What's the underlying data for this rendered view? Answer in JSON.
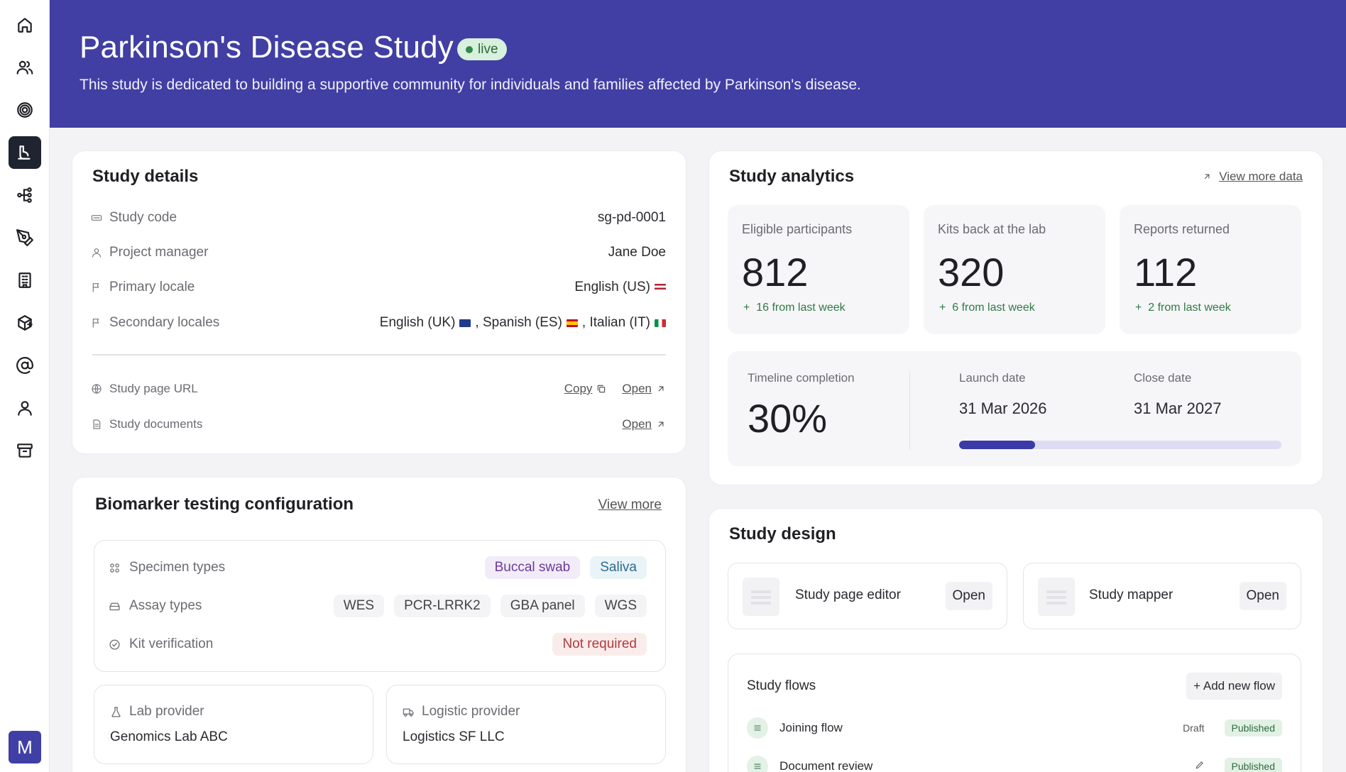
{
  "sidebar": {
    "items": [
      {
        "icon": "home-icon",
        "active": false
      },
      {
        "icon": "users-icon",
        "active": false
      },
      {
        "icon": "target-icon",
        "active": false
      },
      {
        "icon": "study-icon",
        "active": true
      },
      {
        "icon": "flow-icon",
        "active": false
      },
      {
        "icon": "pen-tool-icon",
        "active": false
      },
      {
        "icon": "building-icon",
        "active": false
      },
      {
        "icon": "package-icon",
        "active": false
      },
      {
        "icon": "at-sign-icon",
        "active": false
      },
      {
        "icon": "user-icon",
        "active": false
      },
      {
        "icon": "archive-icon",
        "active": false
      }
    ],
    "avatar_initial": "M"
  },
  "header": {
    "title": "Parkinson's Disease Study",
    "badge": "live",
    "description": "This study is dedicated to building a supportive community for individuals and families affected by Parkinson's disease."
  },
  "study_details": {
    "title": "Study details",
    "rows": [
      {
        "label": "Study code",
        "value": "sg-pd-0001"
      },
      {
        "label": "Project manager",
        "value": "Jane Doe"
      },
      {
        "label": "Primary locale",
        "value": "English (US)"
      },
      {
        "label": "Secondary locales",
        "values": [
          "English (UK)",
          ", Spanish (ES)",
          ", Italian (IT)"
        ]
      }
    ],
    "page_url_label": "Study page URL",
    "documents_label": "Study documents",
    "copy_label": "Copy",
    "open_label": "Open"
  },
  "analytics": {
    "title": "Study analytics",
    "view_more": "View more data",
    "stats": [
      {
        "label": "Eligible participants",
        "value": "812",
        "delta": "16 from last week"
      },
      {
        "label": "Kits back at the lab",
        "value": "320",
        "delta": "6 from last week"
      },
      {
        "label": "Reports returned",
        "value": "112",
        "delta": "2 from last week"
      }
    ],
    "timeline": {
      "label": "Timeline completion",
      "value": "30%",
      "progress": 0.235,
      "launch_label": "Launch date",
      "launch_date": "31 Mar 2026",
      "close_label": "Close date",
      "close_date": "31 Mar 2027"
    }
  },
  "biomarker": {
    "title": "Biomarker testing configuration",
    "view_more": "View more",
    "specimen_label": "Specimen types",
    "specimens": [
      "Buccal swab",
      "Saliva"
    ],
    "assay_label": "Assay types",
    "assays": [
      "WES",
      "PCR-LRRK2",
      "GBA panel",
      "WGS"
    ],
    "kit_label": "Kit verification",
    "kit_value": "Not required",
    "lab_label": "Lab provider",
    "lab_value": "Genomics Lab ABC",
    "logistic_label": "Logistic provider",
    "logistic_value": "Logistics SF LLC"
  },
  "study_design": {
    "title": "Study design",
    "tools": [
      {
        "name": "Study page editor",
        "action": "Open"
      },
      {
        "name": "Study mapper",
        "action": "Open"
      }
    ],
    "flows_title": "Study flows",
    "add_flow": "+ Add new flow",
    "flows": [
      {
        "name": "Joining flow",
        "draft": "Draft",
        "status": "Published"
      },
      {
        "name": "Document review",
        "status": "Published"
      }
    ]
  },
  "colors": {
    "brand": "#413fa3",
    "live": "#2e8b48",
    "positive": "#2f7a45",
    "progress": "#3a3aa8"
  }
}
